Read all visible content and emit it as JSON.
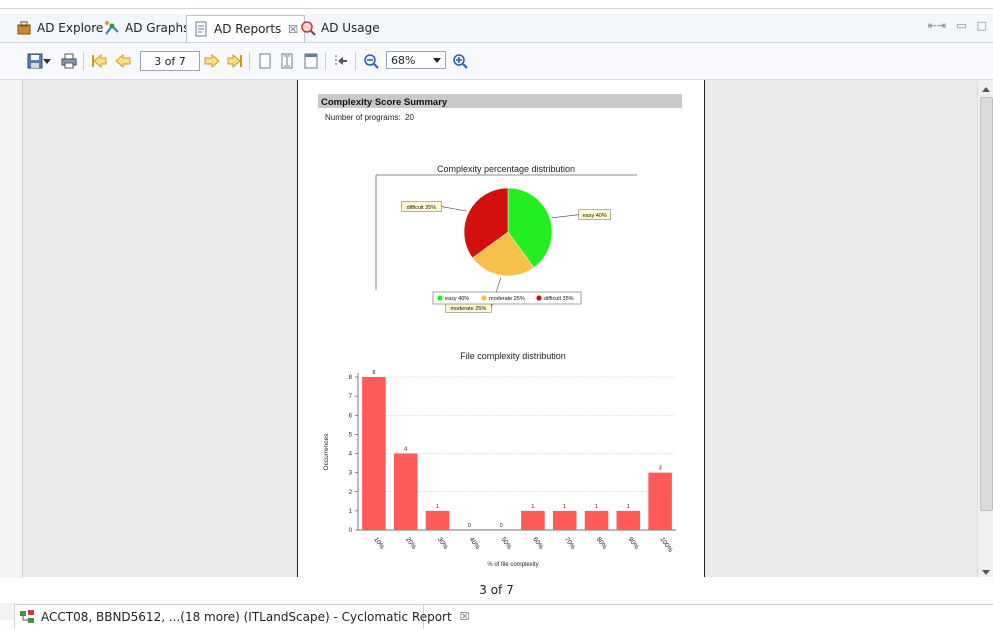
{
  "tabs": [
    {
      "label": "AD Explore",
      "icon": "briefcase-icon"
    },
    {
      "label": "AD Graphs",
      "icon": "graph-icon"
    },
    {
      "label": "AD Reports",
      "icon": "report-icon",
      "close": "☒"
    },
    {
      "label": "AD Usage",
      "icon": "magnifier-icon"
    }
  ],
  "toolbar": {
    "page_field": "3 of 7",
    "zoom_value": "68%"
  },
  "report": {
    "section_title": "Complexity Score Summary",
    "programs_label": "Number of programs:",
    "programs_value": "20"
  },
  "chart_data": [
    {
      "type": "pie",
      "title": "Complexity percentage distribution",
      "categories": [
        "easy",
        "moderate",
        "difficult"
      ],
      "values": [
        40,
        25,
        35
      ],
      "slice_labels": [
        "easy 40%",
        "moderate 25%",
        "difficult 35%"
      ],
      "legend": [
        "easy 40%",
        "moderate 25%",
        "difficult 35%"
      ],
      "legend_placement": "bottom",
      "colors": [
        "#22ee22",
        "#f6c24b",
        "#d40f0f"
      ]
    },
    {
      "type": "bar",
      "title": "File complexity distribution",
      "categories": [
        "10%",
        "20%",
        "30%",
        "40%",
        "50%",
        "60%",
        "70%",
        "80%",
        "90%",
        "100%"
      ],
      "values": [
        8,
        4,
        1,
        0,
        0,
        1,
        1,
        1,
        1,
        3
      ],
      "ylabel": "Occurrences",
      "xlabel": "% of file complexity",
      "ylim": [
        0,
        8
      ],
      "yticks": [
        0,
        1,
        2,
        3,
        4,
        5,
        6,
        7,
        8
      ],
      "color": "#ff5a5a",
      "grid": true
    }
  ],
  "footer": {
    "page_indicator": "3 of 7"
  },
  "status": {
    "label": "ACCT08, BBND5612, ...(18 more) (ITLandScape) - Cyclomatic Report",
    "close": "☒"
  }
}
